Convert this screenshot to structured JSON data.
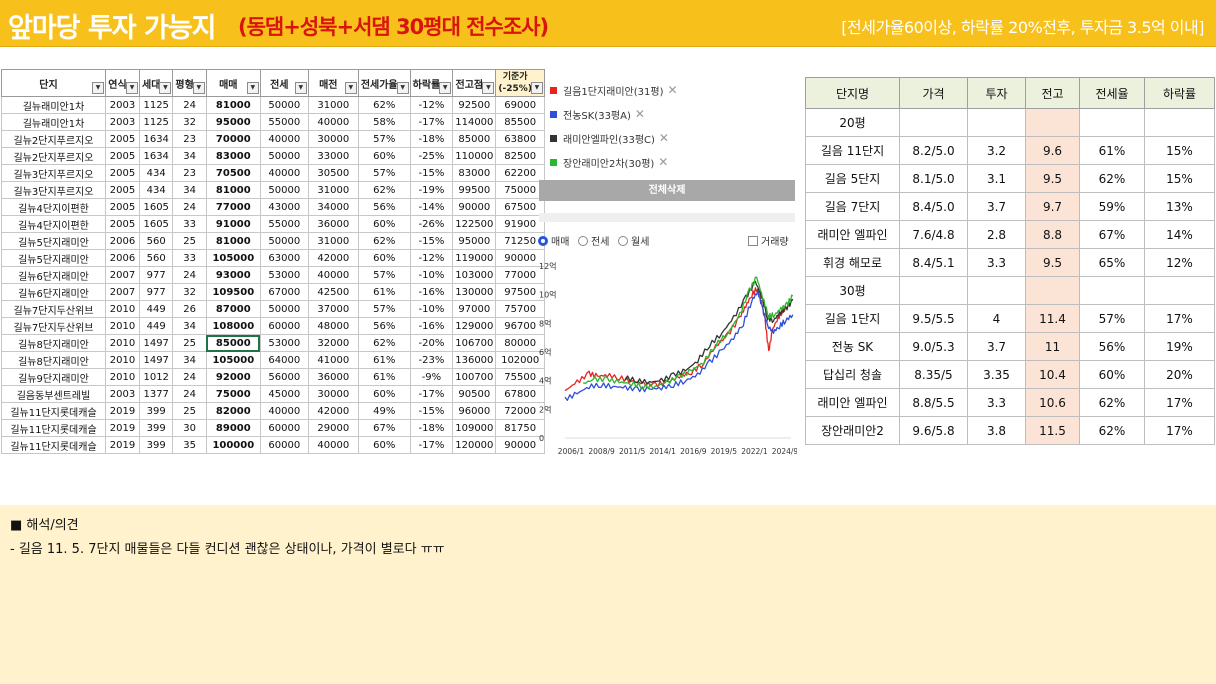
{
  "header": {
    "title": "앞마당 투자 가능지",
    "subtitle": "(동댐+성북+서댐 30평대 전수조사)",
    "criteria": "[전세가율60이상, 하락률 20%전후, 투자금 3.5억 이내]"
  },
  "sheet": {
    "headers": [
      "단지",
      "연식",
      "세대",
      "평형",
      "매매",
      "전세",
      "매전",
      "전세가율",
      "하락률",
      "전고점",
      "기준가\n(-25%)"
    ],
    "rows": [
      [
        "길뉴래미안1차",
        "2003",
        "1125",
        "24",
        "81000",
        "50000",
        "31000",
        "62%",
        "-12%",
        "92500",
        "69000"
      ],
      [
        "길뉴래미안1차",
        "2003",
        "1125",
        "32",
        "95000",
        "55000",
        "40000",
        "58%",
        "-17%",
        "114000",
        "85500"
      ],
      [
        "길뉴2단지푸르지오",
        "2005",
        "1634",
        "23",
        "70000",
        "40000",
        "30000",
        "57%",
        "-18%",
        "85000",
        "63800"
      ],
      [
        "길뉴2단지푸르지오",
        "2005",
        "1634",
        "34",
        "83000",
        "50000",
        "33000",
        "60%",
        "-25%",
        "110000",
        "82500"
      ],
      [
        "길뉴3단지푸르지오",
        "2005",
        "434",
        "23",
        "70500",
        "40000",
        "30500",
        "57%",
        "-15%",
        "83000",
        "62200"
      ],
      [
        "길뉴3단지푸르지오",
        "2005",
        "434",
        "34",
        "81000",
        "50000",
        "31000",
        "62%",
        "-19%",
        "99500",
        "75000"
      ],
      [
        "길뉴4단지이편한",
        "2005",
        "1605",
        "24",
        "77000",
        "43000",
        "34000",
        "56%",
        "-14%",
        "90000",
        "67500"
      ],
      [
        "길뉴4단지이편한",
        "2005",
        "1605",
        "33",
        "91000",
        "55000",
        "36000",
        "60%",
        "-26%",
        "122500",
        "91900"
      ],
      [
        "길뉴5단지래미안",
        "2006",
        "560",
        "25",
        "81000",
        "50000",
        "31000",
        "62%",
        "-15%",
        "95000",
        "71250"
      ],
      [
        "길뉴5단지래미안",
        "2006",
        "560",
        "33",
        "105000",
        "63000",
        "42000",
        "60%",
        "-12%",
        "119000",
        "90000"
      ],
      [
        "길뉴6단지래미안",
        "2007",
        "977",
        "24",
        "93000",
        "53000",
        "40000",
        "57%",
        "-10%",
        "103000",
        "77000"
      ],
      [
        "길뉴6단지래미안",
        "2007",
        "977",
        "32",
        "109500",
        "67000",
        "42500",
        "61%",
        "-16%",
        "130000",
        "97500"
      ],
      [
        "길뉴7단지두산위브",
        "2010",
        "449",
        "26",
        "87000",
        "50000",
        "37000",
        "57%",
        "-10%",
        "97000",
        "75700"
      ],
      [
        "길뉴7단지두산위브",
        "2010",
        "449",
        "34",
        "108000",
        "60000",
        "48000",
        "56%",
        "-16%",
        "129000",
        "96700"
      ],
      [
        "길뉴8단지래미안",
        "2010",
        "1497",
        "25",
        "85000",
        "53000",
        "32000",
        "62%",
        "-20%",
        "106700",
        "80000"
      ],
      [
        "길뉴8단지래미안",
        "2010",
        "1497",
        "34",
        "105000",
        "64000",
        "41000",
        "61%",
        "-23%",
        "136000",
        "102000"
      ],
      [
        "길뉴9단지래미안",
        "2010",
        "1012",
        "24",
        "92000",
        "56000",
        "36000",
        "61%",
        "-9%",
        "100700",
        "75500"
      ],
      [
        "길음동부센트레빌",
        "2003",
        "1377",
        "24",
        "75000",
        "45000",
        "30000",
        "60%",
        "-17%",
        "90500",
        "67800"
      ],
      [
        "길뉴11단지롯데캐슬",
        "2019",
        "399",
        "25",
        "82000",
        "40000",
        "42000",
        "49%",
        "-15%",
        "96000",
        "72000"
      ],
      [
        "길뉴11단지롯데캐슬",
        "2019",
        "399",
        "30",
        "89000",
        "60000",
        "29000",
        "67%",
        "-18%",
        "109000",
        "81750"
      ],
      [
        "길뉴11단지롯데캐슬",
        "2019",
        "399",
        "35",
        "100000",
        "60000",
        "40000",
        "60%",
        "-17%",
        "120000",
        "90000"
      ]
    ]
  },
  "legend": {
    "items": [
      {
        "label": "길음1단지래미안(31평)",
        "color": "#e8231f"
      },
      {
        "label": "전농SK(33평A)",
        "color": "#2f4fd6"
      },
      {
        "label": "래미안엘파인(33평C)",
        "color": "#333333"
      },
      {
        "label": "장안래미안2차(30평)",
        "color": "#2db52d"
      }
    ],
    "close_glyph": "✕",
    "delete_all": "전체삭제"
  },
  "chart_controls": {
    "trade": "매매",
    "jeonse": "전세",
    "wolse": "월세",
    "volume": "거래량"
  },
  "chart_data": {
    "type": "line",
    "yunit": "억",
    "ylim": [
      0,
      12
    ],
    "yticks": [
      "0",
      "2억",
      "4억",
      "6억",
      "8억",
      "10억",
      "12억"
    ],
    "xticks": [
      "2006/1",
      "2008/9",
      "2011/5",
      "2014/1",
      "2016/9",
      "2019/5",
      "2022/1",
      "2024/9"
    ],
    "series": [
      {
        "name": "길음1단지래미안(31평)",
        "color": "#e8231f",
        "points": [
          [
            2006.0,
            3.3
          ],
          [
            2007.0,
            3.9
          ],
          [
            2008.0,
            4.5
          ],
          [
            2008.7,
            4.3
          ],
          [
            2009.5,
            4.4
          ],
          [
            2010.5,
            4.2
          ],
          [
            2011.5,
            4.0
          ],
          [
            2012.5,
            3.8
          ],
          [
            2013.5,
            3.7
          ],
          [
            2014.5,
            3.9
          ],
          [
            2015.5,
            4.3
          ],
          [
            2016.5,
            4.6
          ],
          [
            2017.5,
            5.2
          ],
          [
            2018.5,
            6.4
          ],
          [
            2019.5,
            7.2
          ],
          [
            2020.5,
            8.4
          ],
          [
            2021.0,
            9.2
          ],
          [
            2021.5,
            10.0
          ],
          [
            2022.0,
            10.5
          ],
          [
            2022.3,
            9.5
          ],
          [
            2022.6,
            8.2
          ],
          [
            2022.9,
            6.0
          ],
          [
            2023.2,
            7.5
          ],
          [
            2023.6,
            8.3
          ],
          [
            2024.0,
            8.8
          ],
          [
            2024.5,
            9.2
          ],
          [
            2024.9,
            9.7
          ]
        ]
      },
      {
        "name": "전농SK(33평A)",
        "color": "#2f4fd6",
        "points": [
          [
            2006.0,
            2.7
          ],
          [
            2007.0,
            3.1
          ],
          [
            2008.0,
            3.6
          ],
          [
            2009.0,
            3.7
          ],
          [
            2010.0,
            3.6
          ],
          [
            2011.0,
            3.5
          ],
          [
            2012.0,
            3.4
          ],
          [
            2013.0,
            3.4
          ],
          [
            2014.0,
            3.5
          ],
          [
            2015.0,
            3.7
          ],
          [
            2016.0,
            4.0
          ],
          [
            2017.0,
            4.4
          ],
          [
            2018.0,
            5.3
          ],
          [
            2019.0,
            6.1
          ],
          [
            2020.0,
            7.0
          ],
          [
            2020.8,
            8.0
          ],
          [
            2021.5,
            9.6
          ],
          [
            2022.0,
            10.2
          ],
          [
            2022.4,
            9.0
          ],
          [
            2022.8,
            7.8
          ],
          [
            2023.3,
            7.4
          ],
          [
            2023.8,
            7.8
          ],
          [
            2024.3,
            8.2
          ],
          [
            2024.9,
            8.6
          ]
        ]
      },
      {
        "name": "래미안엘파인(33평C)",
        "color": "#333333",
        "points": [
          [
            2011.0,
            4.2
          ],
          [
            2012.0,
            4.0
          ],
          [
            2013.0,
            3.9
          ],
          [
            2014.0,
            4.0
          ],
          [
            2015.0,
            4.4
          ],
          [
            2016.0,
            4.7
          ],
          [
            2017.0,
            5.4
          ],
          [
            2018.0,
            6.5
          ],
          [
            2019.0,
            7.3
          ],
          [
            2020.0,
            8.4
          ],
          [
            2021.0,
            9.8
          ],
          [
            2021.8,
            10.9
          ],
          [
            2022.3,
            9.9
          ],
          [
            2022.8,
            8.4
          ],
          [
            2023.3,
            8.2
          ],
          [
            2023.8,
            8.7
          ],
          [
            2024.3,
            9.0
          ],
          [
            2024.9,
            9.6
          ]
        ]
      },
      {
        "name": "장안래미안2차(30평)",
        "color": "#2db52d",
        "points": [
          [
            2007.5,
            3.8
          ],
          [
            2008.5,
            4.1
          ],
          [
            2009.5,
            4.1
          ],
          [
            2010.5,
            3.9
          ],
          [
            2011.5,
            3.8
          ],
          [
            2012.5,
            3.6
          ],
          [
            2013.5,
            3.6
          ],
          [
            2014.5,
            3.9
          ],
          [
            2015.5,
            4.3
          ],
          [
            2016.5,
            4.7
          ],
          [
            2017.5,
            5.3
          ],
          [
            2018.5,
            6.5
          ],
          [
            2019.5,
            7.3
          ],
          [
            2020.5,
            8.6
          ],
          [
            2021.3,
            10.3
          ],
          [
            2021.9,
            11.2
          ],
          [
            2022.4,
            9.8
          ],
          [
            2022.9,
            8.5
          ],
          [
            2023.4,
            8.6
          ],
          [
            2023.9,
            9.0
          ],
          [
            2024.4,
            9.3
          ],
          [
            2024.9,
            9.9
          ]
        ]
      }
    ]
  },
  "summary": {
    "headers": [
      "단지명",
      "가격",
      "투자",
      "전고",
      "전세율",
      "하락률"
    ],
    "rows": [
      [
        "20평",
        "",
        "",
        "",
        "",
        ""
      ],
      [
        "길음 11단지",
        "8.2/5.0",
        "3.2",
        "9.6",
        "61%",
        "15%"
      ],
      [
        "길음 5단지",
        "8.1/5.0",
        "3.1",
        "9.5",
        "62%",
        "15%"
      ],
      [
        "길음 7단지",
        "8.4/5.0",
        "3.7",
        "9.7",
        "59%",
        "13%"
      ],
      [
        "래미안 엘파인",
        "7.6/4.8",
        "2.8",
        "8.8",
        "67%",
        "14%"
      ],
      [
        "휘경 해모로",
        "8.4/5.1",
        "3.3",
        "9.5",
        "65%",
        "12%"
      ],
      [
        "30평",
        "",
        "",
        "",
        "",
        ""
      ],
      [
        "길음 1단지",
        "9.5/5.5",
        "4",
        "11.4",
        "57%",
        "17%"
      ],
      [
        "전농 SK",
        "9.0/5.3",
        "3.7",
        "11",
        "56%",
        "19%"
      ],
      [
        "답십리 청솔",
        "8.35/5",
        "3.35",
        "10.4",
        "60%",
        "20%"
      ],
      [
        "래미안 엘파인",
        "8.8/5.5",
        "3.3",
        "10.6",
        "62%",
        "17%"
      ],
      [
        "장안래미안2",
        "9.6/5.8",
        "3.8",
        "11.5",
        "62%",
        "17%"
      ]
    ]
  },
  "notes": {
    "title": "■ 해석/의견",
    "line1": "-  길음 11. 5. 7단지 매물들은 다들 컨디션 괜찮은 상태이나, 가격이 별로다 ㅠㅠ"
  },
  "colors": {
    "header_bg": "#f8c01a",
    "subtitle": "#d8140c",
    "note_bg": "#fff2cc",
    "summary_header_bg": "#ebf1dd",
    "peak_cell_bg": "#fbe4d6"
  }
}
